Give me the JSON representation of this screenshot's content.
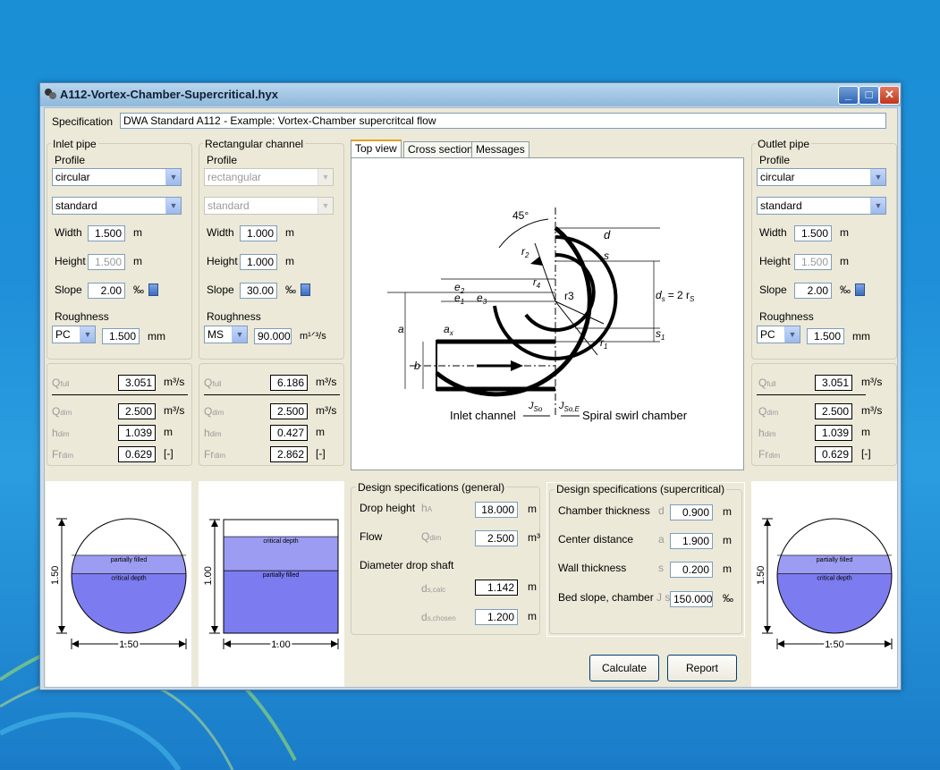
{
  "window": {
    "title": "A112-Vortex-Chamber-Supercritical.hyx"
  },
  "specification": {
    "label": "Specification",
    "value": "DWA Standard A112 - Example: Vortex-Chamber supercritcal flow"
  },
  "inlet": {
    "title": "Inlet pipe",
    "profile_label": "Profile",
    "profile": "circular",
    "type": "standard",
    "width_label": "Width",
    "width": "1.500",
    "width_unit": "m",
    "height_label": "Height",
    "height": "1.500",
    "height_unit": "m",
    "slope_label": "Slope",
    "slope": "2.00",
    "slope_unit": "‰",
    "roughness_label": "Roughness",
    "roughness_type": "PC",
    "roughness": "1.500",
    "roughness_unit": "mm",
    "q_full": "3.051",
    "q_dim": "2.500",
    "h_dim": "1.039",
    "fr_dim": "0.629"
  },
  "channel": {
    "title": "Rectangular channel",
    "profile_label": "Profile",
    "profile": "rectangular",
    "type": "standard",
    "width_label": "Width",
    "width": "1.000",
    "width_unit": "m",
    "height_label": "Height",
    "height": "1.000",
    "height_unit": "m",
    "slope_label": "Slope",
    "slope": "30.00",
    "slope_unit": "‰",
    "roughness_label": "Roughness",
    "roughness_type": "MS",
    "roughness": "90.000",
    "roughness_unit": "m¹ᐟ³/s",
    "q_full": "6.186",
    "q_dim": "2.500",
    "h_dim": "0.427",
    "fr_dim": "2.862"
  },
  "outlet": {
    "title": "Outlet pipe",
    "profile_label": "Profile",
    "profile": "circular",
    "type": "standard",
    "width_label": "Width",
    "width": "1.500",
    "width_unit": "m",
    "height_label": "Height",
    "height": "1.500",
    "height_unit": "m",
    "slope_label": "Slope",
    "slope": "2.00",
    "slope_unit": "‰",
    "roughness_label": "Roughness",
    "roughness_type": "PC",
    "roughness": "1.500",
    "roughness_unit": "mm",
    "q_full": "3.051",
    "q_dim": "2.500",
    "h_dim": "1.039",
    "fr_dim": "0.629"
  },
  "results_labels": {
    "q": "Q",
    "full": "full",
    "dim": "dim",
    "h": "h",
    "fr": "Fr",
    "q_unit": "m³/s",
    "h_unit": "m",
    "fr_unit": "[-]"
  },
  "tabs": [
    "Top view",
    "Cross section",
    "Messages"
  ],
  "diagram": {
    "angle": "45°",
    "inlet_label": "Inlet channel",
    "chamber_label": "Spiral swirl chamber",
    "d": "d",
    "s": "s",
    "s1": "s",
    "s1_sub": "1",
    "ds": "d",
    "ds_sub": "s",
    "ds_eq": "= 2 r",
    "ds_eq_sub": "S",
    "r1": "r",
    "r1_sub": "1",
    "r2": "r",
    "r2_sub": "2",
    "r3": "r3",
    "r4": "r",
    "r4_sub": "4",
    "e1": "e",
    "e1_sub": "1",
    "e2": "e",
    "e2_sub": "2",
    "e3": "e",
    "e3_sub": "3",
    "a": "a",
    "ax": "a",
    "ax_sub": "x",
    "b": "b",
    "jso": "J",
    "jso_sub": "So",
    "jsoe": "J",
    "jsoe_sub": "So,E"
  },
  "design_general": {
    "title": "Design specifications (general)",
    "drop_height_label": "Drop height",
    "drop_height_sym": "h",
    "drop_height_sym_sub": "A",
    "drop_height": "18.000",
    "drop_height_unit": "m",
    "flow_label": "Flow",
    "flow_sym": "Q",
    "flow_sym_sub": "dim",
    "flow": "2.500",
    "flow_unit": "m³",
    "diameter_label": "Diameter drop shaft",
    "ds_calc_sym": "d",
    "ds_calc_sub": "s,calc",
    "ds_calc": "1.142",
    "ds_calc_unit": "m",
    "ds_chosen_sym": "d",
    "ds_chosen_sub": "s,chosen",
    "ds_chosen": "1.200",
    "ds_chosen_unit": "m"
  },
  "design_super": {
    "title": "Design specifications (supercritical)",
    "chamber_label": "Chamber thickness",
    "chamber_sym": "d",
    "chamber": "0.900",
    "chamber_unit": "m",
    "center_label": "Center distance",
    "center_sym": "a",
    "center": "1.900",
    "center_unit": "m",
    "wall_label": "Wall thickness",
    "wall_sym": "s",
    "wall": "0.200",
    "wall_unit": "m",
    "bed_label": "Bed slope, chamber",
    "bed_sym": "J s",
    "bed": "150.000",
    "bed_unit": "‰"
  },
  "buttons": {
    "calculate": "Calculate",
    "report": "Report"
  },
  "cross_inlet": {
    "partial": "partially filled",
    "critical": "critical depth",
    "dim_h": "1.50",
    "dim_w": "1.50",
    "fill_partial": 0.68,
    "fill_critical": 0.52
  },
  "cross_channel": {
    "partial": "partially filled",
    "critical": "critical depth",
    "dim_h": "1.00",
    "dim_w": "1.00",
    "fill_partial": 0.55,
    "fill_critical": 0.85
  },
  "cross_outlet": {
    "partial": "partially filled",
    "critical": "critical depth",
    "dim_h": "1.50",
    "dim_w": "1.50",
    "fill_partial": 0.68,
    "fill_critical": 0.52
  },
  "colors": {
    "fill_partial": "#9c9cf2",
    "fill_critical": "#7c7cf0",
    "title_grad": "#8fb8da"
  }
}
